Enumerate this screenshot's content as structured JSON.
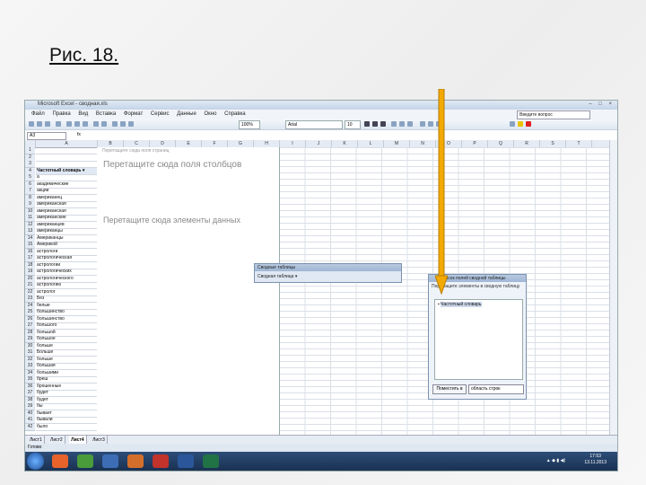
{
  "slide": {
    "title": "Рис. 18."
  },
  "window": {
    "title": "Microsoft Excel - сводная.xls",
    "controls": "– □ ×",
    "help_placeholder": "Введите вопрос"
  },
  "menu": [
    "Файл",
    "Правка",
    "Вид",
    "Вставка",
    "Формат",
    "Сервис",
    "Данные",
    "Окно",
    "Справка"
  ],
  "toolbar": {
    "zoom": "100%",
    "font": "Arial",
    "size": "10"
  },
  "formula": {
    "cell": "A3",
    "fx": "fx"
  },
  "columns": [
    "A",
    "B",
    "C",
    "D",
    "E",
    "F",
    "G",
    "H",
    "I",
    "J",
    "K",
    "L",
    "M",
    "N",
    "O",
    "P",
    "Q",
    "R",
    "S",
    "T"
  ],
  "pivot": {
    "filter_hint": "Перетащите сюда поля страниц",
    "column_hint": "Перетащите сюда поля столбцов",
    "data_hint": "Перетащите сюда элементы данных",
    "row_field": "Частотный словарь"
  },
  "rows": [
    {
      "n": "1",
      "a": ""
    },
    {
      "n": "2",
      "a": ""
    },
    {
      "n": "3",
      "a": ""
    },
    {
      "n": "4",
      "a": "Частотный словарь ▾"
    },
    {
      "n": "5",
      "a": "а"
    },
    {
      "n": "6",
      "a": "академические"
    },
    {
      "n": "7",
      "a": "акции"
    },
    {
      "n": "8",
      "a": "американец"
    },
    {
      "n": "9",
      "a": "американская"
    },
    {
      "n": "10",
      "a": "американская"
    },
    {
      "n": "11",
      "a": "американские"
    },
    {
      "n": "12",
      "a": "американцев"
    },
    {
      "n": "13",
      "a": "американцы"
    },
    {
      "n": "14",
      "a": "Американцы"
    },
    {
      "n": "15",
      "a": "Америкой"
    },
    {
      "n": "16",
      "a": "астрологи"
    },
    {
      "n": "17",
      "a": "астрологическая"
    },
    {
      "n": "18",
      "a": "астрологии"
    },
    {
      "n": "19",
      "a": "астрологических"
    },
    {
      "n": "20",
      "a": "астрологического"
    },
    {
      "n": "21",
      "a": "астрологию"
    },
    {
      "n": "22",
      "a": "астролог"
    },
    {
      "n": "23",
      "a": "Без"
    },
    {
      "n": "24",
      "a": "белые"
    },
    {
      "n": "25",
      "a": "большинство"
    },
    {
      "n": "26",
      "a": "большинство"
    },
    {
      "n": "27",
      "a": "большого"
    },
    {
      "n": "28",
      "a": "большой"
    },
    {
      "n": "29",
      "a": "большое"
    },
    {
      "n": "30",
      "a": "больше"
    },
    {
      "n": "31",
      "a": "Больше"
    },
    {
      "n": "32",
      "a": "больше"
    },
    {
      "n": "33",
      "a": "большая"
    },
    {
      "n": "34",
      "a": "большими"
    },
    {
      "n": "35",
      "a": "бреш"
    },
    {
      "n": "36",
      "a": "брошенные"
    },
    {
      "n": "37",
      "a": "будет"
    },
    {
      "n": "38",
      "a": "будет"
    },
    {
      "n": "39",
      "a": "бы"
    },
    {
      "n": "40",
      "a": "бывает"
    },
    {
      "n": "41",
      "a": "бывали"
    },
    {
      "n": "42",
      "a": "было"
    }
  ],
  "pivot_toolbar": {
    "title": "Сводные таблицы",
    "menu": "Сводная таблица ▾"
  },
  "field_list": {
    "title": "Список полей сводной таблицы",
    "subtitle": "Перетащите элементы в сводную таблицу",
    "items": [
      "Частотный словарь"
    ],
    "add_button": "Поместить в",
    "area_select": "область строк"
  },
  "sheets": [
    "Лист1",
    "Лист2",
    "Лист4",
    "Лист3"
  ],
  "status": "Готово",
  "taskbar": {
    "time": "17:53",
    "date": "13.11.2013"
  },
  "colors": {
    "accent": "#1a3152",
    "arrow": "#f2a900"
  }
}
